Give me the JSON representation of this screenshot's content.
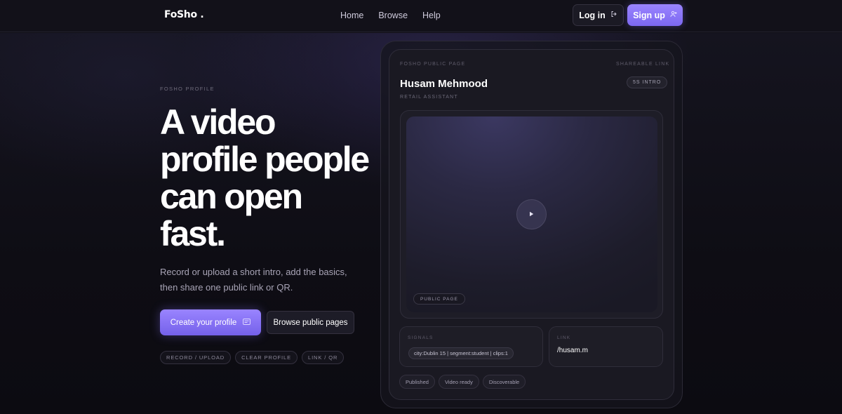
{
  "nav": {
    "logo": "FoSho .",
    "links": [
      "Home",
      "Browse",
      "Help"
    ],
    "login_label": "Log in",
    "signup_label": "Sign up"
  },
  "hero": {
    "eyebrow": "FOSHO PROFILE",
    "headline": "A video profile people can open fast.",
    "subtext": "Record or upload a short intro, add the basics, then share one public link or QR.",
    "primary_cta": "Create your profile",
    "secondary_cta": "Browse public pages",
    "chips": [
      "RECORD / UPLOAD",
      "CLEAR PROFILE",
      "LINK / QR"
    ]
  },
  "card": {
    "top_left_label": "FOSHO PUBLIC PAGE",
    "top_right_label": "SHAREABLE LINK",
    "name": "Husam Mehmood",
    "role": "RETAIL ASSISTANT",
    "intro_badge": "5S INTRO",
    "video_chip": "PUBLIC PAGE",
    "signals_label": "SIGNALS",
    "signals_value": "city:Dublin 15 | segment:student | clips:1",
    "link_label": "LINK",
    "link_value": "/husam.m",
    "status_chips": [
      "Published",
      "Video ready",
      "Discoverable"
    ]
  },
  "icons": {
    "login": "logout-arrow-icon",
    "signup": "user-plus-icon",
    "create": "id-card-icon",
    "play": "play-icon"
  },
  "colors": {
    "accent": "#8b76fb",
    "background": "#0f0e16"
  }
}
